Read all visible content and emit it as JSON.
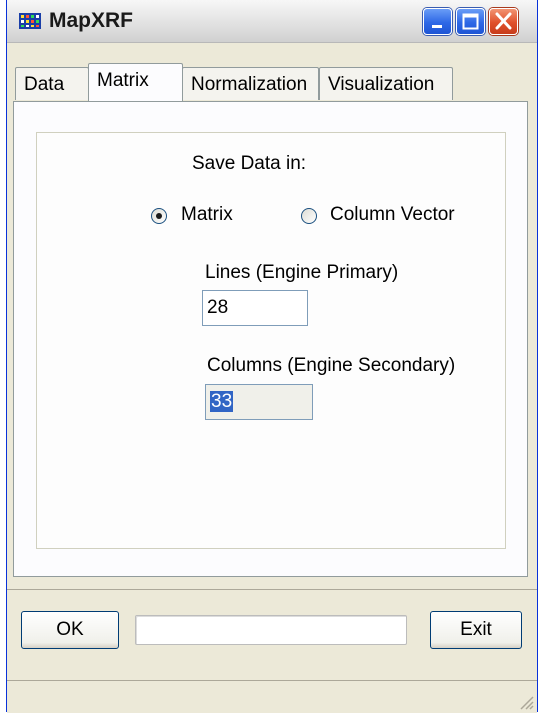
{
  "window": {
    "title": "MapXRF",
    "accent_color": "#0831d9",
    "controls": [
      "minimize-icon",
      "maximize-icon",
      "close-icon"
    ]
  },
  "tabs": [
    {
      "label": "Data",
      "active": false
    },
    {
      "label": "Matrix",
      "active": true
    },
    {
      "label": "Normalization",
      "active": false
    },
    {
      "label": "Visualization",
      "active": false
    }
  ],
  "matrix_panel": {
    "save_label": "Save Data in:",
    "radio_matrix_label": "Matrix",
    "radio_matrix_selected": true,
    "radio_column_label": "Column Vector",
    "radio_column_selected": false,
    "lines_label": "Lines (Engine Primary)",
    "lines_value": "28",
    "columns_label": "Columns (Engine Secondary)",
    "columns_value": "33"
  },
  "footer": {
    "ok_label": "OK",
    "exit_label": "Exit",
    "progress_value": 0
  }
}
